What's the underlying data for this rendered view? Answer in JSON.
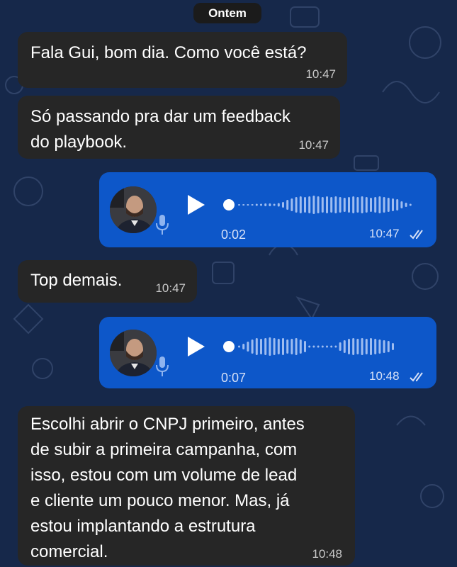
{
  "date_label": "Ontem",
  "colors": {
    "background": "#16284a",
    "incoming": "#262626",
    "outgoing": "#0d57c9"
  },
  "messages": [
    {
      "type": "text",
      "direction": "incoming",
      "text": "Fala Gui, bom dia. Como você está?",
      "time": "10:47"
    },
    {
      "type": "text",
      "direction": "incoming",
      "text": "Só passando pra dar um feedback\ndo playbook.",
      "time": "10:47"
    },
    {
      "type": "voice",
      "direction": "outgoing",
      "duration": "0:02",
      "time": "10:47",
      "progress": 0
    },
    {
      "type": "text",
      "direction": "incoming",
      "text": "Top demais.",
      "time": "10:47"
    },
    {
      "type": "voice",
      "direction": "outgoing",
      "duration": "0:07",
      "time": "10:48",
      "progress": 0
    },
    {
      "type": "text",
      "direction": "incoming",
      "text": "Escolhi abrir o CNPJ primeiro, antes\nde subir a primeira campanha, com\nisso, estou com um volume de lead\ne cliente um pouco menor. Mas, já\nestou implantando a estrutura\ncomercial.",
      "time": "10:48"
    }
  ]
}
